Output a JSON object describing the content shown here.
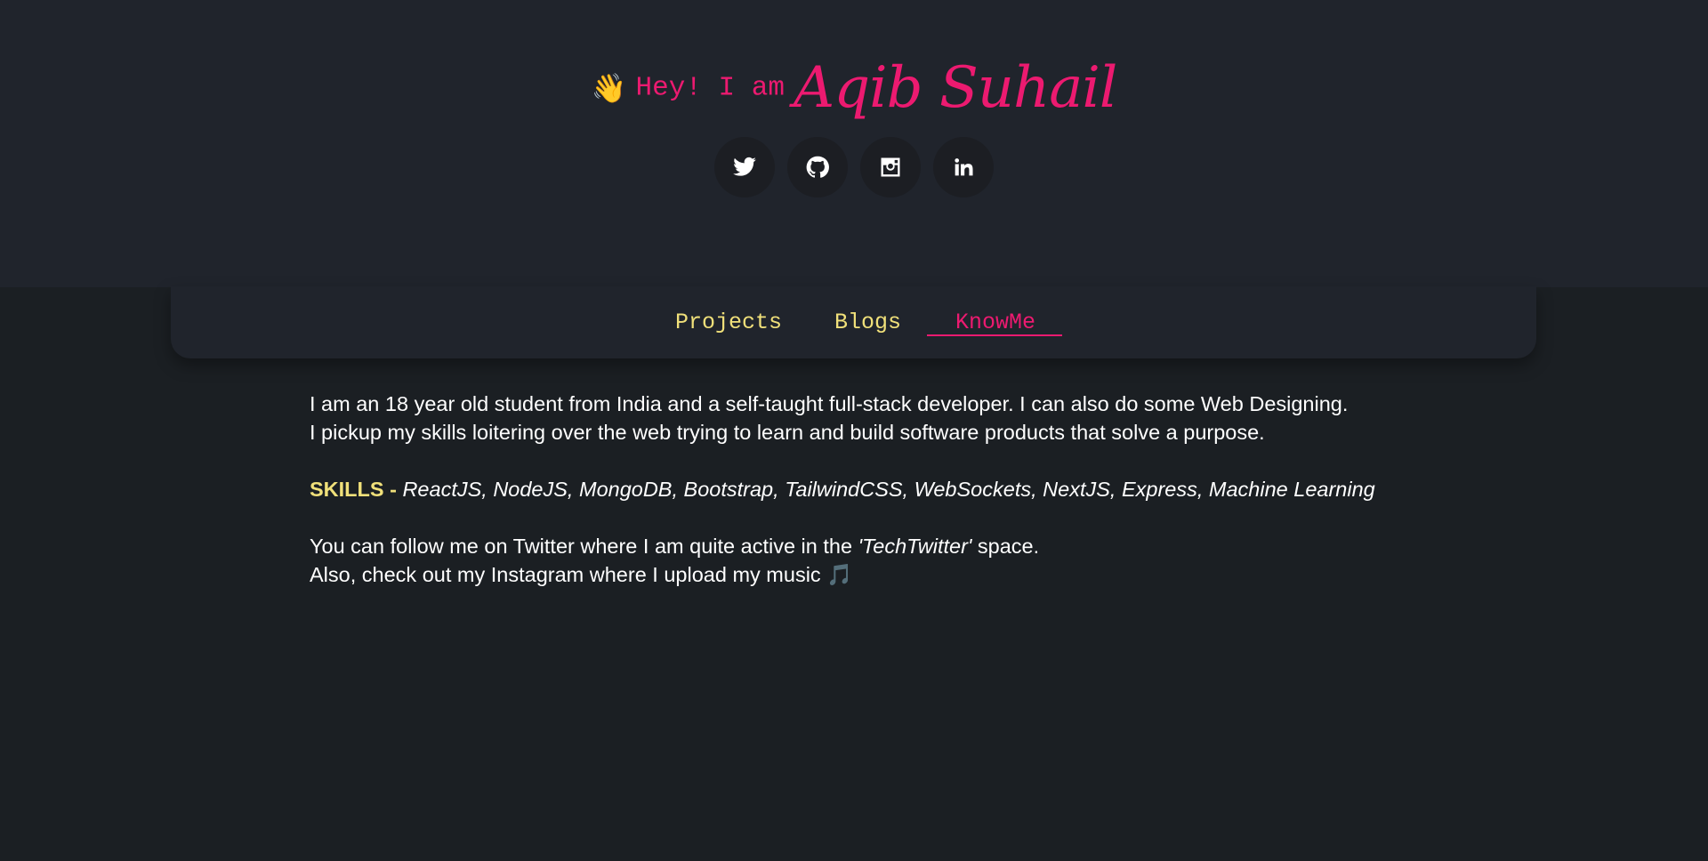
{
  "hero": {
    "wave": "👋",
    "greeting": "Hey! I am",
    "name": "Aqib Suhail",
    "socials": [
      {
        "icon": "twitter-icon"
      },
      {
        "icon": "github-icon"
      },
      {
        "icon": "instagram-icon"
      },
      {
        "icon": "linkedin-icon"
      }
    ]
  },
  "nav": {
    "items": [
      {
        "label": "Projects"
      },
      {
        "label": "Blogs"
      },
      {
        "label": "KnowMe",
        "active": true
      }
    ]
  },
  "about": {
    "line1": "I am an 18 year old student from India and a self-taught full-stack developer. I can also do some Web Designing.",
    "line2": "I pickup my skills loitering over the web trying to learn and build software products that solve a purpose.",
    "skills_label": "SKILLS -",
    "skills": "ReactJS, NodeJS, MongoDB, Bootstrap, TailwindCSS, WebSockets, NextJS, Express, Machine Learning",
    "follow_prefix": "You can follow me on Twitter where I am quite active in the",
    "follow_emph": "'TechTwitter'",
    "follow_suffix": "space.",
    "insta_line": "Also, check out my Instagram where I upload my music",
    "music_note": "🎵"
  },
  "colors": {
    "accent_pink": "#ec1a70",
    "accent_yellow": "#f0e07a",
    "hero_bg": "#20242c",
    "page_bg": "#1b1f23"
  }
}
